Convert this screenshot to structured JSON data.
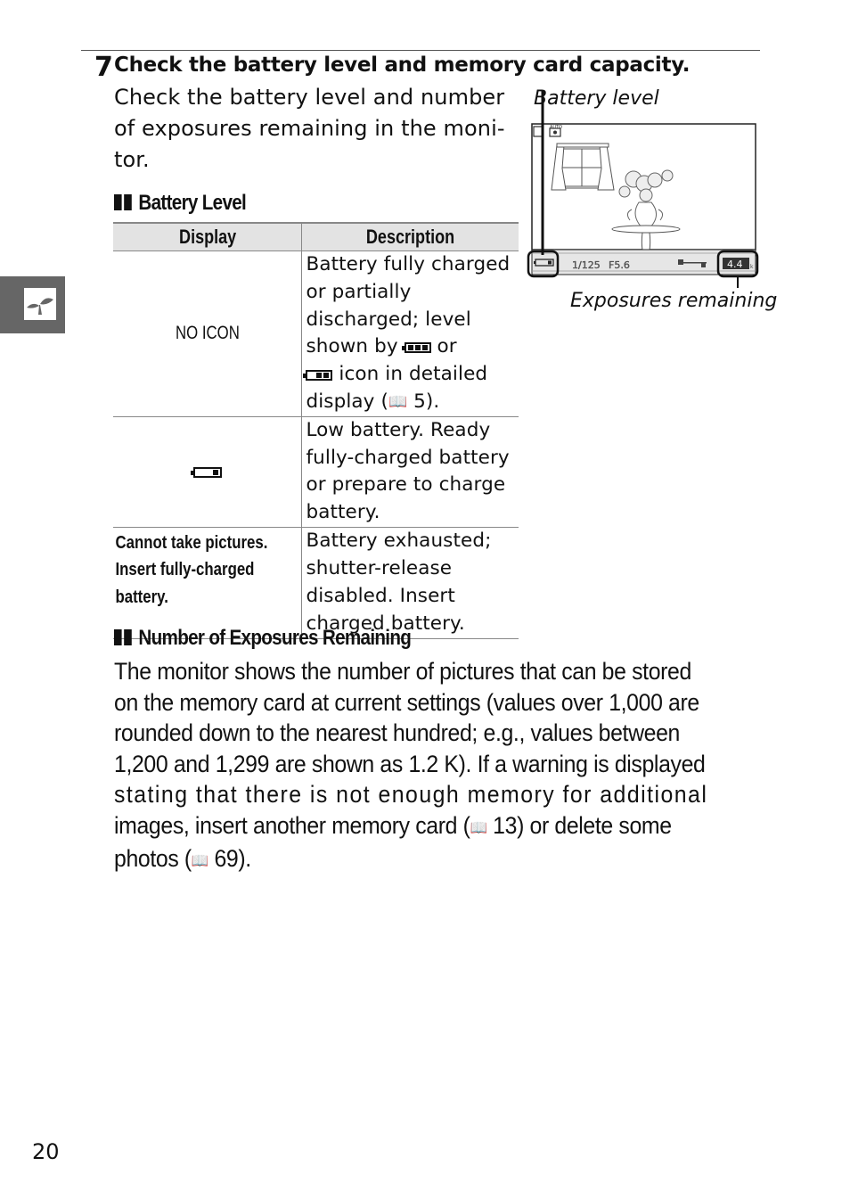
{
  "step": {
    "number": "7",
    "title": "Check the battery level and memory card capacity.",
    "intro_lines": [
      "Check the battery level and number",
      "of exposures remaining in the moni-",
      "tor."
    ]
  },
  "illustration": {
    "battery_callout": "Battery level",
    "exposures_callout": "Exposures remaining",
    "shutter_speed": "1/125",
    "aperture": "F5.6",
    "exposures_remaining": "4.4",
    "exposures_suffix": "k"
  },
  "battery_section": {
    "heading": "Battery Level",
    "columns": [
      "Display",
      "Description"
    ],
    "rows": [
      {
        "display": "NO ICON",
        "display_type": "text",
        "description_parts": [
          "Battery fully charged or partially discharged; level shown by ",
          " or ",
          " icon in detailed display (",
          " 5)."
        ],
        "icons": [
          "battery-full-icon",
          "battery-partial-icon",
          "book-reference-icon"
        ]
      },
      {
        "display": "",
        "display_type": "icon",
        "display_icon": "battery-low-icon",
        "description": "Low battery. Ready fully-charged battery or prepare to charge battery."
      },
      {
        "display_lines": [
          "Cannot take pictures.",
          "Insert fully-charged",
          "battery."
        ],
        "display_type": "bold-text",
        "description": "Battery exhausted; shutter-release disabled. Insert charged battery."
      }
    ]
  },
  "exposures_section": {
    "heading": "Number of Exposures Remaining",
    "lines": [
      "The monitor shows the number of pictures that can be stored",
      "on the memory card at current settings (values over 1,000 are",
      "rounded down to the nearest hundred; e.g., values between",
      "1,200 and 1,299 are shown as 1.2 K). If a warning is displayed",
      "stating that there is not enough memory for additional",
      "images, insert another memory card (",
      " 13) or delete some",
      "photos (",
      " 69)."
    ]
  },
  "side_tab": {
    "icon": "sprout-icon"
  },
  "page_number": "20",
  "colors": {
    "side_tab": "#666666",
    "table_header": "#e3e3e3",
    "rule": "#888888"
  }
}
